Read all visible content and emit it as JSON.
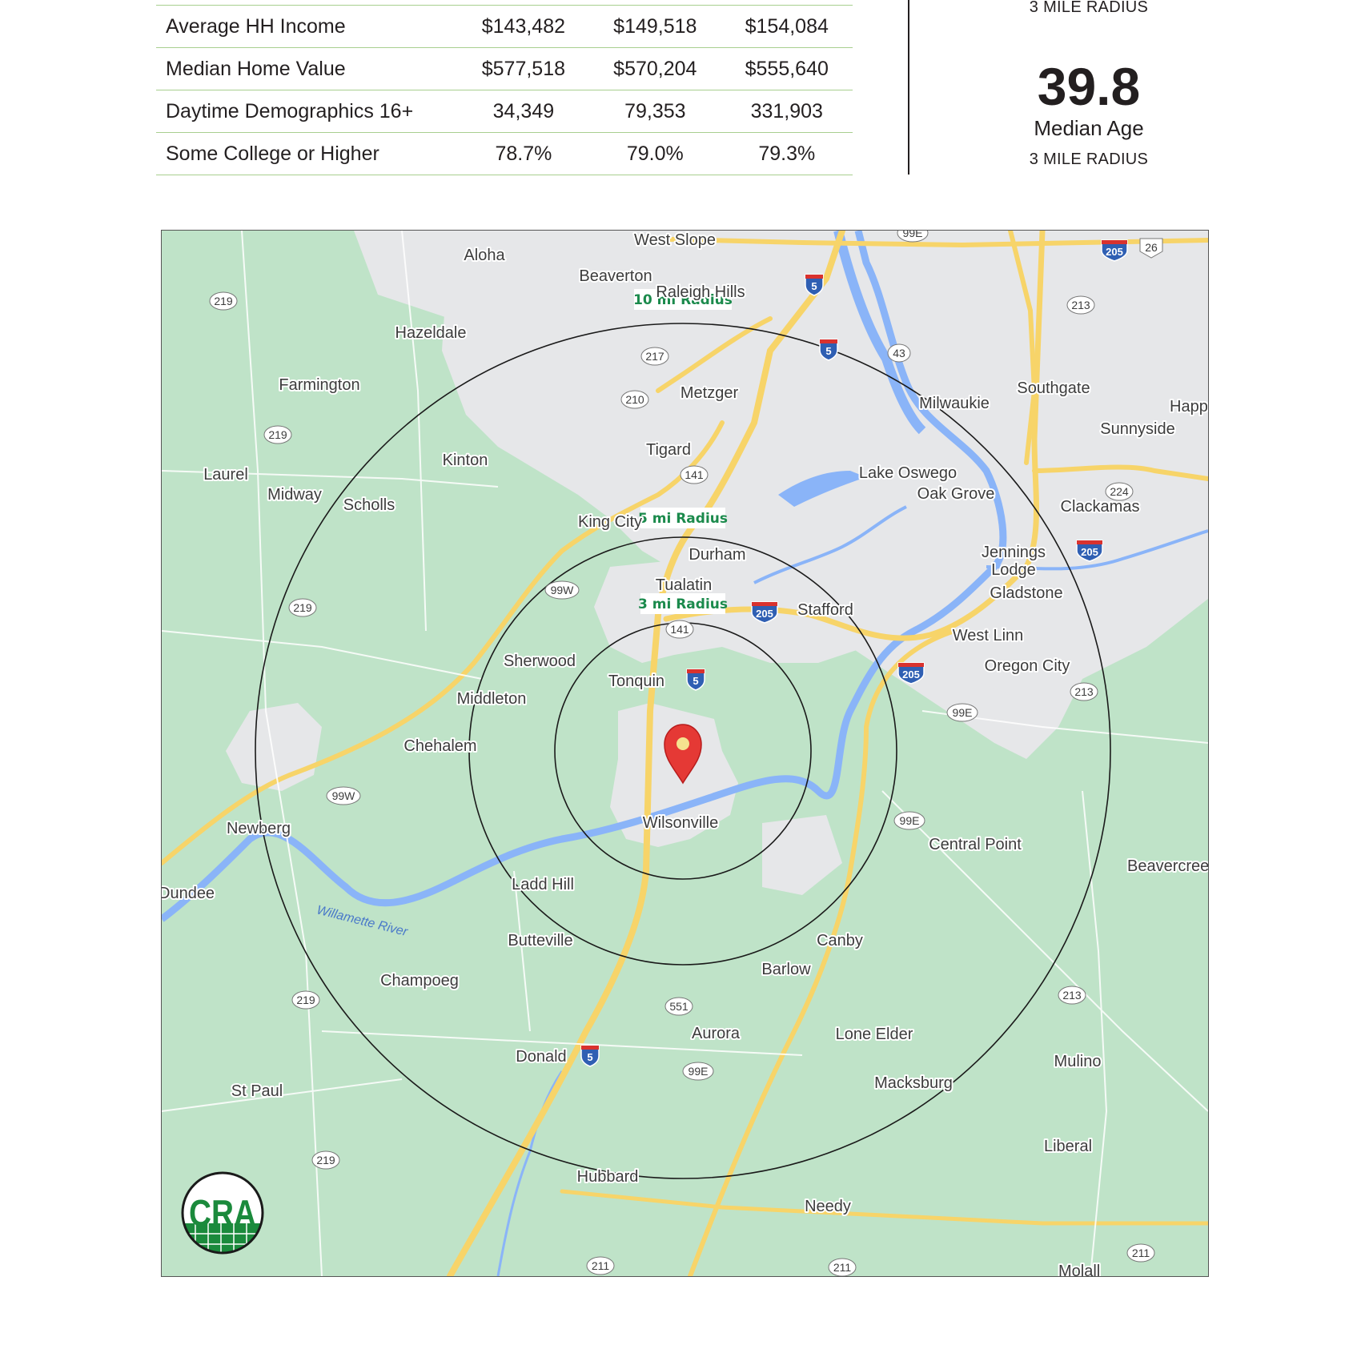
{
  "demographics": {
    "rows": [
      {
        "label": "Average HH Income",
        "values": [
          "$143,482",
          "$149,518",
          "$154,084"
        ]
      },
      {
        "label": "Median Home Value",
        "values": [
          "$577,518",
          "$570,204",
          "$555,640"
        ]
      },
      {
        "label": "Daytime Demographics 16+",
        "values": [
          "34,349",
          "79,353",
          "331,903"
        ]
      },
      {
        "label": "Some College or Higher",
        "values": [
          "78.7%",
          "79.0%",
          "79.3%"
        ]
      }
    ]
  },
  "stats": {
    "top_caption": "3 MILE RADIUS",
    "median_age_value": "39.8",
    "median_age_label": "Median Age",
    "median_age_caption": "3 MILE RADIUS"
  },
  "map": {
    "center_place": "Wilsonville",
    "radius_labels": {
      "r10": "10 mi Radius",
      "r5": "5 mi Radius",
      "r3": "3 mi Radius"
    },
    "river_label": "Willamette River",
    "logo_text": "CRA",
    "colors": {
      "land": "#bfe3c8",
      "urban": "#eaeaea",
      "highway": "#f7d469",
      "water": "#8ab4f8",
      "pin": "#e53935",
      "brand_green": "#1b8a3c"
    },
    "places": {
      "west_slope": "West Slope",
      "aloha": "Aloha",
      "beaverton": "Beaverton",
      "raleigh_hills": "Raleigh Hills",
      "hazeldale": "Hazeldale",
      "farmington": "Farmington",
      "metzger": "Metzger",
      "milwaukie": "Milwaukie",
      "southgate": "Southgate",
      "happy_valley": "Happ",
      "sunnyside": "Sunnyside",
      "tigard": "Tigard",
      "kinton": "Kinton",
      "laurel": "Laurel",
      "midway": "Midway",
      "scholls": "Scholls",
      "lake_oswego": "Lake Oswego",
      "oak_grove": "Oak Grove",
      "clackamas": "Clackamas",
      "king_city": "King City",
      "durham": "Durham",
      "jennings_lodge_1": "Jennings",
      "jennings_lodge_2": "Lodge",
      "tualatin": "Tualatin",
      "gladstone": "Gladstone",
      "stafford": "Stafford",
      "west_linn": "West Linn",
      "sherwood": "Sherwood",
      "tonquin": "Tonquin",
      "oregon_city": "Oregon City",
      "middleton": "Middleton",
      "chehalem": "Chehalem",
      "wilsonville": "Wilsonville",
      "newberg": "Newberg",
      "central_point": "Central Point",
      "beavercreek": "Beavercree",
      "dundee": "Dundee",
      "ladd_hill": "Ladd Hill",
      "canby": "Canby",
      "butteville": "Butteville",
      "barlow": "Barlow",
      "champoeg": "Champoeg",
      "aurora": "Aurora",
      "lone_elder": "Lone Elder",
      "donald": "Donald",
      "mulino": "Mulino",
      "st_paul": "St Paul",
      "macksburg": "Macksburg",
      "liberal": "Liberal",
      "hubbard": "Hubbard",
      "needy": "Needy",
      "molalla": "Molall"
    },
    "route_shields": {
      "s219a": "219",
      "s219b": "219",
      "s219c": "219",
      "s219d": "219",
      "s219e": "219",
      "s217": "217",
      "s210": "210",
      "s141a": "141",
      "s141b": "141",
      "s43": "43",
      "s213a": "213",
      "s213b": "213",
      "s213c": "213",
      "s224": "224",
      "s26": "26",
      "s99wa": "99W",
      "s99wb": "99W",
      "s99ea": "99E",
      "s99eb": "99E",
      "s99ec": "99E",
      "s99ed": "99E",
      "s551": "551",
      "s211a": "211",
      "s211b": "211",
      "s211c": "211"
    },
    "interstates": {
      "i5a": "5",
      "i5b": "5",
      "i5c": "5",
      "i5d": "5",
      "i205a": "205",
      "i205b": "205",
      "i205c": "205",
      "i205d": "205"
    }
  }
}
